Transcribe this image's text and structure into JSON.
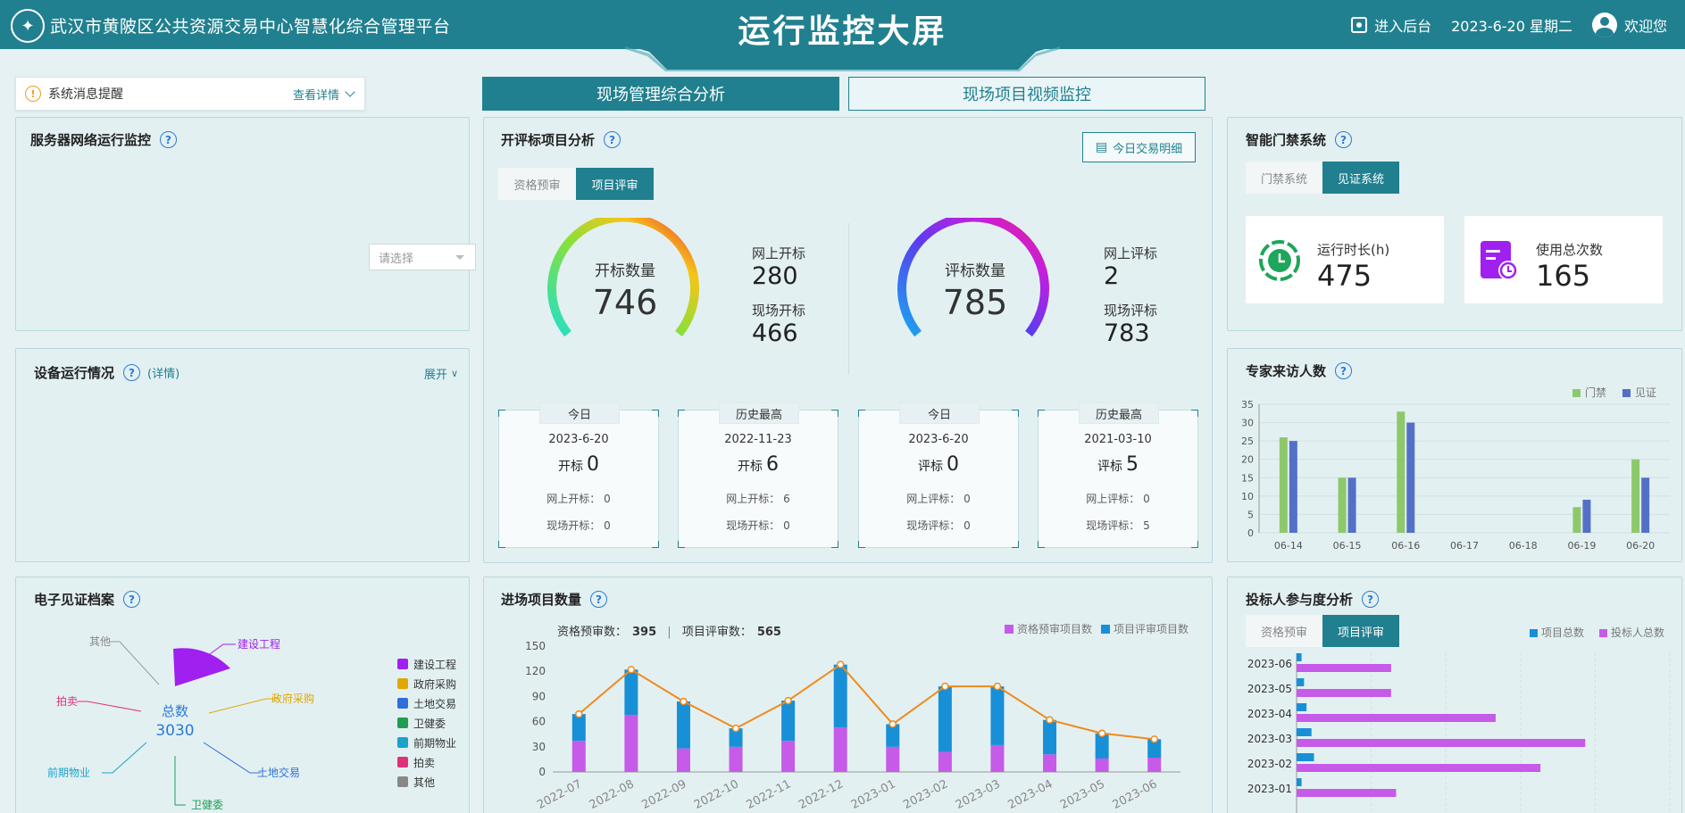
{
  "header": {
    "system_name": "武汉市黄陂区公共资源交易中心智慧化综合管理平台",
    "title": "运行监控大屏",
    "backend_label": "进入后台",
    "datetime": "2023-6-20 星期二",
    "welcome": "欢迎您",
    "colors": {
      "primary": "#21808f",
      "accent": "#2a7ad6"
    }
  },
  "message_bar": {
    "label": "系统消息提醒",
    "detail": "查看详情"
  },
  "main_tabs": [
    {
      "label": "现场管理综合分析",
      "active": true
    },
    {
      "label": "现场项目视频监控",
      "active": false
    }
  ],
  "server_panel": {
    "title": "服务器网络运行监控",
    "select_placeholder": "请选择"
  },
  "device_panel": {
    "title": "设备运行情况",
    "detail_link": "(详情)",
    "expand": "展开"
  },
  "bid_analysis": {
    "title": "开评标项目分析",
    "today_btn": "今日交易明细",
    "tabs": [
      {
        "label": "资格预审",
        "active": false
      },
      {
        "label": "项目评审",
        "active": true
      }
    ],
    "open": {
      "label": "开标数量",
      "value": "746",
      "online_label": "网上开标",
      "online_value": "280",
      "onsite_label": "现场开标",
      "onsite_value": "466"
    },
    "review": {
      "label": "评标数量",
      "value": "785",
      "online_label": "网上评标",
      "online_value": "2",
      "onsite_label": "现场评标",
      "onsite_value": "783"
    },
    "cards": [
      {
        "tag": "今日",
        "date": "2023-6-20",
        "kind": "开标",
        "value": "0",
        "online": "网上开标：  0",
        "onsite": "现场开标：  0"
      },
      {
        "tag": "历史最高",
        "date": "2022-11-23",
        "kind": "开标",
        "value": "6",
        "online": "网上开标：  6",
        "onsite": "现场开标：  0"
      },
      {
        "tag": "今日",
        "date": "2023-6-20",
        "kind": "评标",
        "value": "0",
        "online": "网上评标：  0",
        "onsite": "现场评标：  0"
      },
      {
        "tag": "历史最高",
        "date": "2021-03-10",
        "kind": "评标",
        "value": "5",
        "online": "网上评标：  0",
        "onsite": "现场评标：  5"
      }
    ]
  },
  "access_panel": {
    "title": "智能门禁系统",
    "tabs": [
      {
        "label": "门禁系统",
        "active": false
      },
      {
        "label": "见证系统",
        "active": true
      }
    ],
    "runtime_label": "运行时长(h)",
    "runtime_value": "475",
    "usage_label": "使用总次数",
    "usage_value": "165"
  },
  "expert_panel": {
    "title": "专家来访人数"
  },
  "evidence_panel": {
    "title": "电子见证档案",
    "total_label": "总数",
    "total_value": "3030",
    "labels": {
      "jianshe": "建设工程",
      "zhengfu": "政府采购",
      "tudi": "土地交易",
      "weijian": "卫健委",
      "qianqi": "前期物业",
      "paimai": "拍卖",
      "qita": "其他"
    },
    "legend": [
      {
        "name": "建设工程",
        "color": "#a020f0"
      },
      {
        "name": "政府采购",
        "color": "#e0a800"
      },
      {
        "name": "土地交易",
        "color": "#2f6fd8"
      },
      {
        "name": "卫健委",
        "color": "#1e9e54"
      },
      {
        "name": "前期物业",
        "color": "#1aa3c8"
      },
      {
        "name": "拍卖",
        "color": "#e0307a"
      },
      {
        "name": "其他",
        "color": "#888888"
      }
    ]
  },
  "entry_panel": {
    "title": "进场项目数量",
    "pre_label": "资格预审数：",
    "pre_value": "395",
    "review_label": "项目评审数：",
    "review_value": "565"
  },
  "bidder_panel": {
    "title": "投标人参与度分析",
    "tabs": [
      {
        "label": "资格预审",
        "active": false
      },
      {
        "label": "项目评审",
        "active": true
      }
    ]
  },
  "chart_data": [
    {
      "type": "bar",
      "categories": [
        "06-14",
        "06-15",
        "06-16",
        "06-17",
        "06-18",
        "06-19",
        "06-20"
      ],
      "series": [
        {
          "name": "门禁",
          "values": [
            26,
            15,
            33,
            0,
            0,
            7,
            20
          ],
          "color": "#8dc96b"
        },
        {
          "name": "见证",
          "values": [
            25,
            15,
            30,
            0,
            0,
            9,
            15
          ],
          "color": "#5470c6"
        }
      ],
      "ylim": [
        0,
        35
      ],
      "yticks": [
        0,
        5,
        10,
        15,
        20,
        25,
        30,
        35
      ],
      "grid": true,
      "legend": "top-right"
    },
    {
      "type": "bar",
      "categories": [
        "2022-07",
        "2022-08",
        "2022-09",
        "2022-10",
        "2022-11",
        "2022-12",
        "2023-01",
        "2023-02",
        "2023-03",
        "2023-04",
        "2023-05",
        "2023-06"
      ],
      "series": [
        {
          "name": "资格预审项目数",
          "values": [
            37,
            68,
            28,
            30,
            37,
            53,
            30,
            24,
            32,
            21,
            16,
            17
          ],
          "color": "#c55be8"
        },
        {
          "name": "项目评审项目数",
          "values": [
            32,
            54,
            56,
            22,
            48,
            75,
            27,
            78,
            70,
            41,
            30,
            22
          ],
          "color": "#1890d8"
        }
      ],
      "line": [
        69,
        122,
        84,
        52,
        85,
        128,
        57,
        102,
        102,
        62,
        46,
        39
      ],
      "line_color": "#f08a1c",
      "ylim": [
        0,
        150
      ],
      "yticks": [
        0,
        30,
        60,
        90,
        120,
        150
      ],
      "legend": "top-right",
      "stacked": true
    },
    {
      "type": "bar",
      "orientation": "horizontal",
      "categories": [
        "2023-06",
        "2023-05",
        "2023-04",
        "2023-03",
        "2023-02",
        "2023-01"
      ],
      "series": [
        {
          "name": "项目总数",
          "values": [
            1,
            1.5,
            2,
            3,
            3.5,
            1
          ],
          "color": "#1890d8"
        },
        {
          "name": "投标人总数",
          "values": [
            19,
            19,
            40,
            58,
            49,
            20
          ],
          "color": "#c55be8"
        }
      ],
      "legend": "top-right"
    },
    {
      "type": "pie",
      "categories": [
        "建设工程"
      ],
      "note": "rose-style segment, only 建设工程 slice visible",
      "colors": [
        "#a020f0"
      ]
    }
  ]
}
